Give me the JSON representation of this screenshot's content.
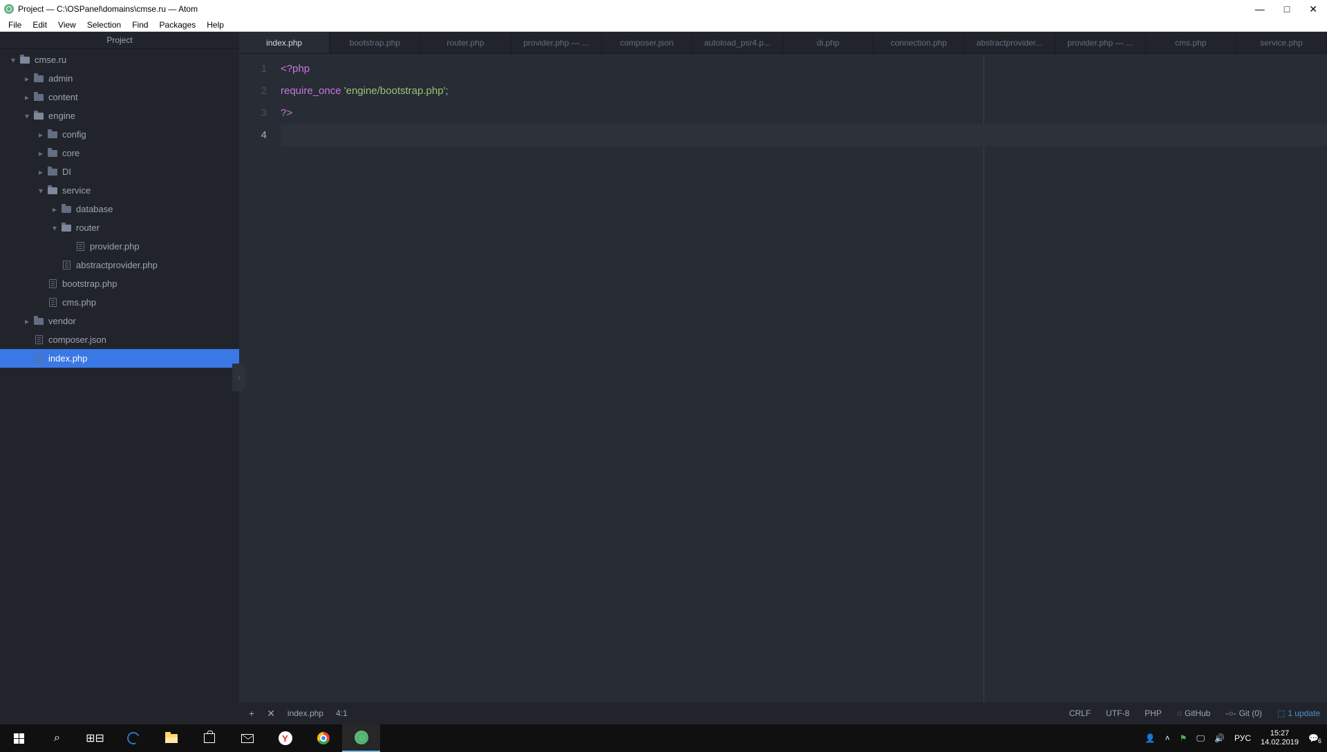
{
  "titlebar": {
    "title": "Project — C:\\OSPanel\\domains\\cmse.ru — Atom"
  },
  "menu": [
    "File",
    "Edit",
    "View",
    "Selection",
    "Find",
    "Packages",
    "Help"
  ],
  "sidebar": {
    "header": "Project",
    "tree": [
      {
        "d": 0,
        "exp": "down",
        "type": "folder-open",
        "label": "cmse.ru"
      },
      {
        "d": 1,
        "exp": "right",
        "type": "folder",
        "label": "admin"
      },
      {
        "d": 1,
        "exp": "right",
        "type": "folder",
        "label": "content"
      },
      {
        "d": 1,
        "exp": "down",
        "type": "folder-open",
        "label": "engine"
      },
      {
        "d": 2,
        "exp": "right",
        "type": "folder",
        "label": "config"
      },
      {
        "d": 2,
        "exp": "right",
        "type": "folder",
        "label": "core"
      },
      {
        "d": 2,
        "exp": "right",
        "type": "folder",
        "label": "DI"
      },
      {
        "d": 2,
        "exp": "down",
        "type": "folder-open",
        "label": "service"
      },
      {
        "d": 3,
        "exp": "right",
        "type": "folder",
        "label": "database"
      },
      {
        "d": 3,
        "exp": "down",
        "type": "folder-open",
        "label": "router"
      },
      {
        "d": 4,
        "exp": "none",
        "type": "file",
        "label": "provider.php"
      },
      {
        "d": 3,
        "exp": "none",
        "type": "file",
        "label": "abstractprovider.php"
      },
      {
        "d": 2,
        "exp": "none",
        "type": "file",
        "label": "bootstrap.php"
      },
      {
        "d": 2,
        "exp": "none",
        "type": "file",
        "label": "cms.php"
      },
      {
        "d": 1,
        "exp": "right",
        "type": "folder",
        "label": "vendor"
      },
      {
        "d": 1,
        "exp": "none",
        "type": "file",
        "label": "composer.json"
      },
      {
        "d": 1,
        "exp": "none",
        "type": "file",
        "label": "index.php",
        "selected": true
      }
    ]
  },
  "tabs": [
    {
      "label": "index.php",
      "active": true
    },
    {
      "label": "bootstrap.php"
    },
    {
      "label": "router.php"
    },
    {
      "label": "provider.php — ..."
    },
    {
      "label": "composer.json"
    },
    {
      "label": "autoload_psr4.p..."
    },
    {
      "label": "di.php"
    },
    {
      "label": "connection.php"
    },
    {
      "label": "abstractprovider..."
    },
    {
      "label": "provider.php — ..."
    },
    {
      "label": "cms.php"
    },
    {
      "label": "service.php"
    }
  ],
  "code": {
    "lines": [
      "1",
      "2",
      "3",
      "4"
    ],
    "l1_open": "<?php",
    "l2_kw": "require_once",
    "l2_sp": " ",
    "l2_str": "'engine/bootstrap.php'",
    "l2_semi": ";",
    "l3_close": "?>",
    "cursor_line": 4
  },
  "status": {
    "file": "index.php",
    "pos": "4:1",
    "eol": "CRLF",
    "enc": "UTF-8",
    "lang": "PHP",
    "github": "GitHub",
    "git": "Git (0)",
    "updates": "1 update"
  },
  "taskbar": {
    "lang": "РУС",
    "time": "15:27",
    "date": "14.02.2019",
    "notif": "6"
  }
}
